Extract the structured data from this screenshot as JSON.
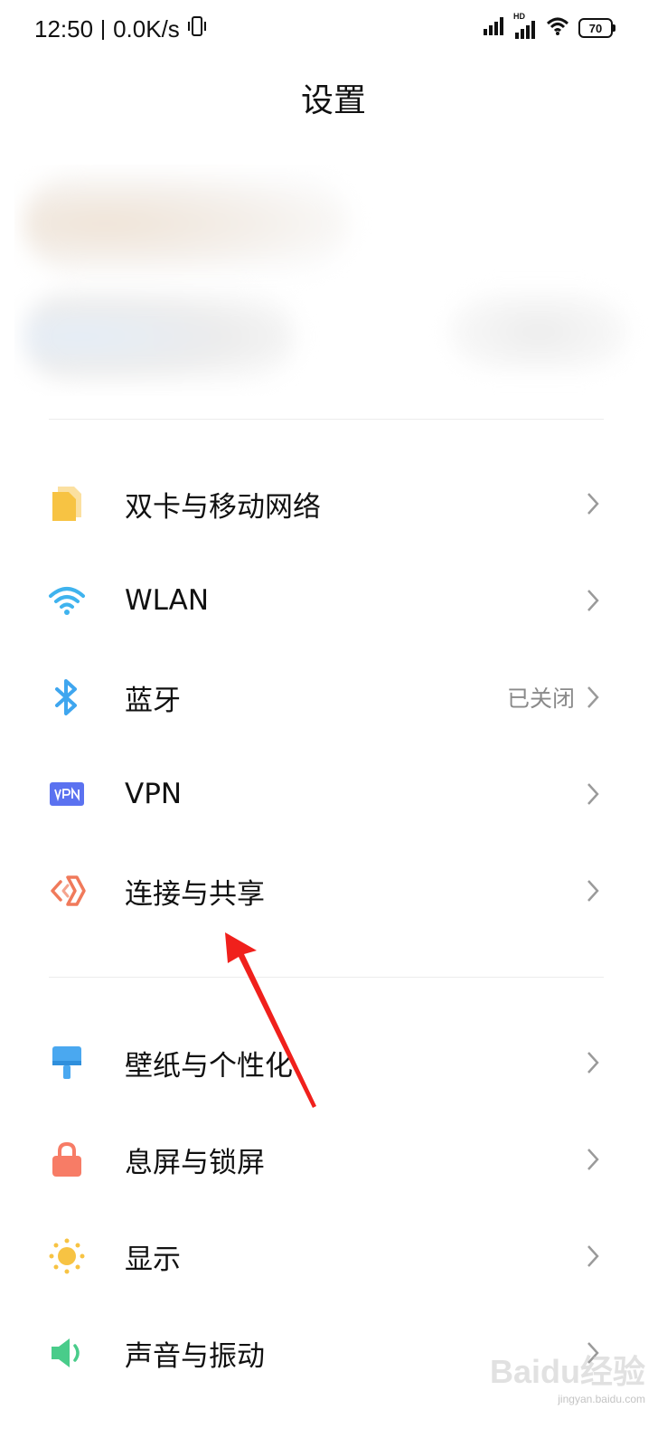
{
  "status_bar": {
    "time": "12:50",
    "network_speed": "0.0K/s",
    "signal_badge": "HD",
    "battery_level": "70"
  },
  "header": {
    "title": "设置"
  },
  "sections": [
    {
      "items": [
        {
          "label": "双卡与移动网络",
          "value": "",
          "icon": "dual-sim-icon",
          "color": "#f7c343"
        },
        {
          "label": "WLAN",
          "value": "",
          "icon": "wifi-icon",
          "color": "#3fb3ee"
        },
        {
          "label": "蓝牙",
          "value": "已关闭",
          "icon": "bluetooth-icon",
          "color": "#3fa6ef"
        },
        {
          "label": "VPN",
          "value": "",
          "icon": "vpn-icon",
          "color": "#5b72f0"
        },
        {
          "label": "连接与共享",
          "value": "",
          "icon": "connection-share-icon",
          "color": "#f07a5b"
        }
      ]
    },
    {
      "items": [
        {
          "label": "壁纸与个性化",
          "value": "",
          "icon": "wallpaper-icon",
          "color": "#4aa8f0"
        },
        {
          "label": "息屏与锁屏",
          "value": "",
          "icon": "lock-icon",
          "color": "#f77c66"
        },
        {
          "label": "显示",
          "value": "",
          "icon": "brightness-icon",
          "color": "#f7c343"
        },
        {
          "label": "声音与振动",
          "value": "",
          "icon": "speaker-icon",
          "color": "#49cc8a"
        }
      ]
    }
  ],
  "watermark": {
    "brand": "Baidu经验",
    "url": "jingyan.baidu.com"
  },
  "annotation": {
    "arrow_color": "#f0201c"
  }
}
